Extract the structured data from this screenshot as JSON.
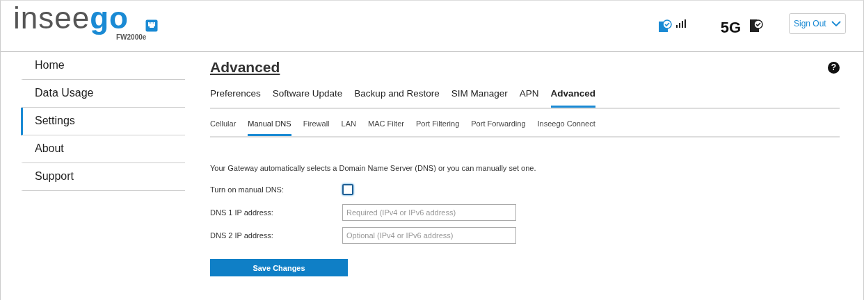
{
  "header": {
    "logo": "insee**go**",
    "model": "FW2000e",
    "network": "5G",
    "sign_out": "Sign Out"
  },
  "sidebar": {
    "items": [
      {
        "label": "Home",
        "selected": false
      },
      {
        "label": "Data Usage",
        "selected": false
      },
      {
        "label": "Settings",
        "selected": true
      },
      {
        "label": "About",
        "selected": false
      },
      {
        "label": "Support",
        "selected": false
      }
    ]
  },
  "page": {
    "title": "Advanced",
    "help": "?",
    "tabs": [
      {
        "label": "Preferences",
        "selected": false
      },
      {
        "label": "Software Update",
        "selected": false
      },
      {
        "label": "Backup and Restore",
        "selected": false
      },
      {
        "label": "SIM Manager",
        "selected": false
      },
      {
        "label": "APN",
        "selected": false
      },
      {
        "label": "Advanced",
        "selected": true
      }
    ],
    "subtabs": [
      {
        "label": "Cellular",
        "selected": false
      },
      {
        "label": "Manual DNS",
        "selected": true
      },
      {
        "label": "Firewall",
        "selected": false
      },
      {
        "label": "LAN",
        "selected": false
      },
      {
        "label": "MAC Filter",
        "selected": false
      },
      {
        "label": "Port Filtering",
        "selected": false
      },
      {
        "label": "Port Forwarding",
        "selected": false
      },
      {
        "label": "Inseego Connect",
        "selected": false
      }
    ],
    "description": "Your Gateway automatically selects a Domain Name Server (DNS) or you can manually set one.",
    "manual_dns": {
      "label": "Turn on manual DNS:",
      "checked": false
    },
    "fields": [
      {
        "label": "DNS 1 IP address:",
        "placeholder": "Required (IPv4 or IPv6 address)"
      },
      {
        "label": "DNS 2 IP address:",
        "placeholder": "Optional (IPv4 or IPv6 address)"
      }
    ],
    "save": "Save Changes"
  }
}
